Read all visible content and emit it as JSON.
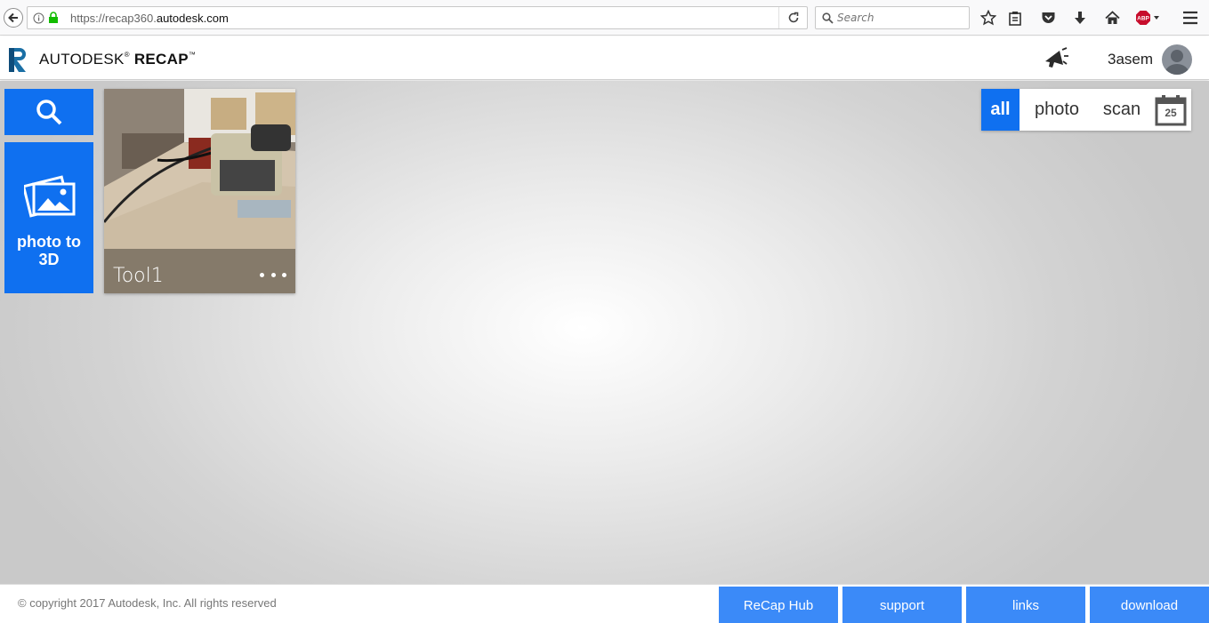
{
  "browser": {
    "url_prefix": "https://recap360.",
    "url_domain": "autodesk.com",
    "search_placeholder": "Search"
  },
  "header": {
    "brand_light": "AUTODESK",
    "brand_bold": "RECAP",
    "username": "3asem"
  },
  "sidebar": {
    "photo_to_3d_line1": "photo to",
    "photo_to_3d_line2": "3D"
  },
  "projects": [
    {
      "name": "Tool1"
    }
  ],
  "filter": {
    "all": "all",
    "photo": "photo",
    "scan": "scan",
    "calendar_day": "25"
  },
  "footer": {
    "copyright": "© copyright 2017 Autodesk, Inc. All rights reserved",
    "links": [
      "ReCap Hub",
      "support",
      "links",
      "download"
    ]
  },
  "colors": {
    "accent": "#0f70f0",
    "footer_button": "#3b8af8"
  }
}
